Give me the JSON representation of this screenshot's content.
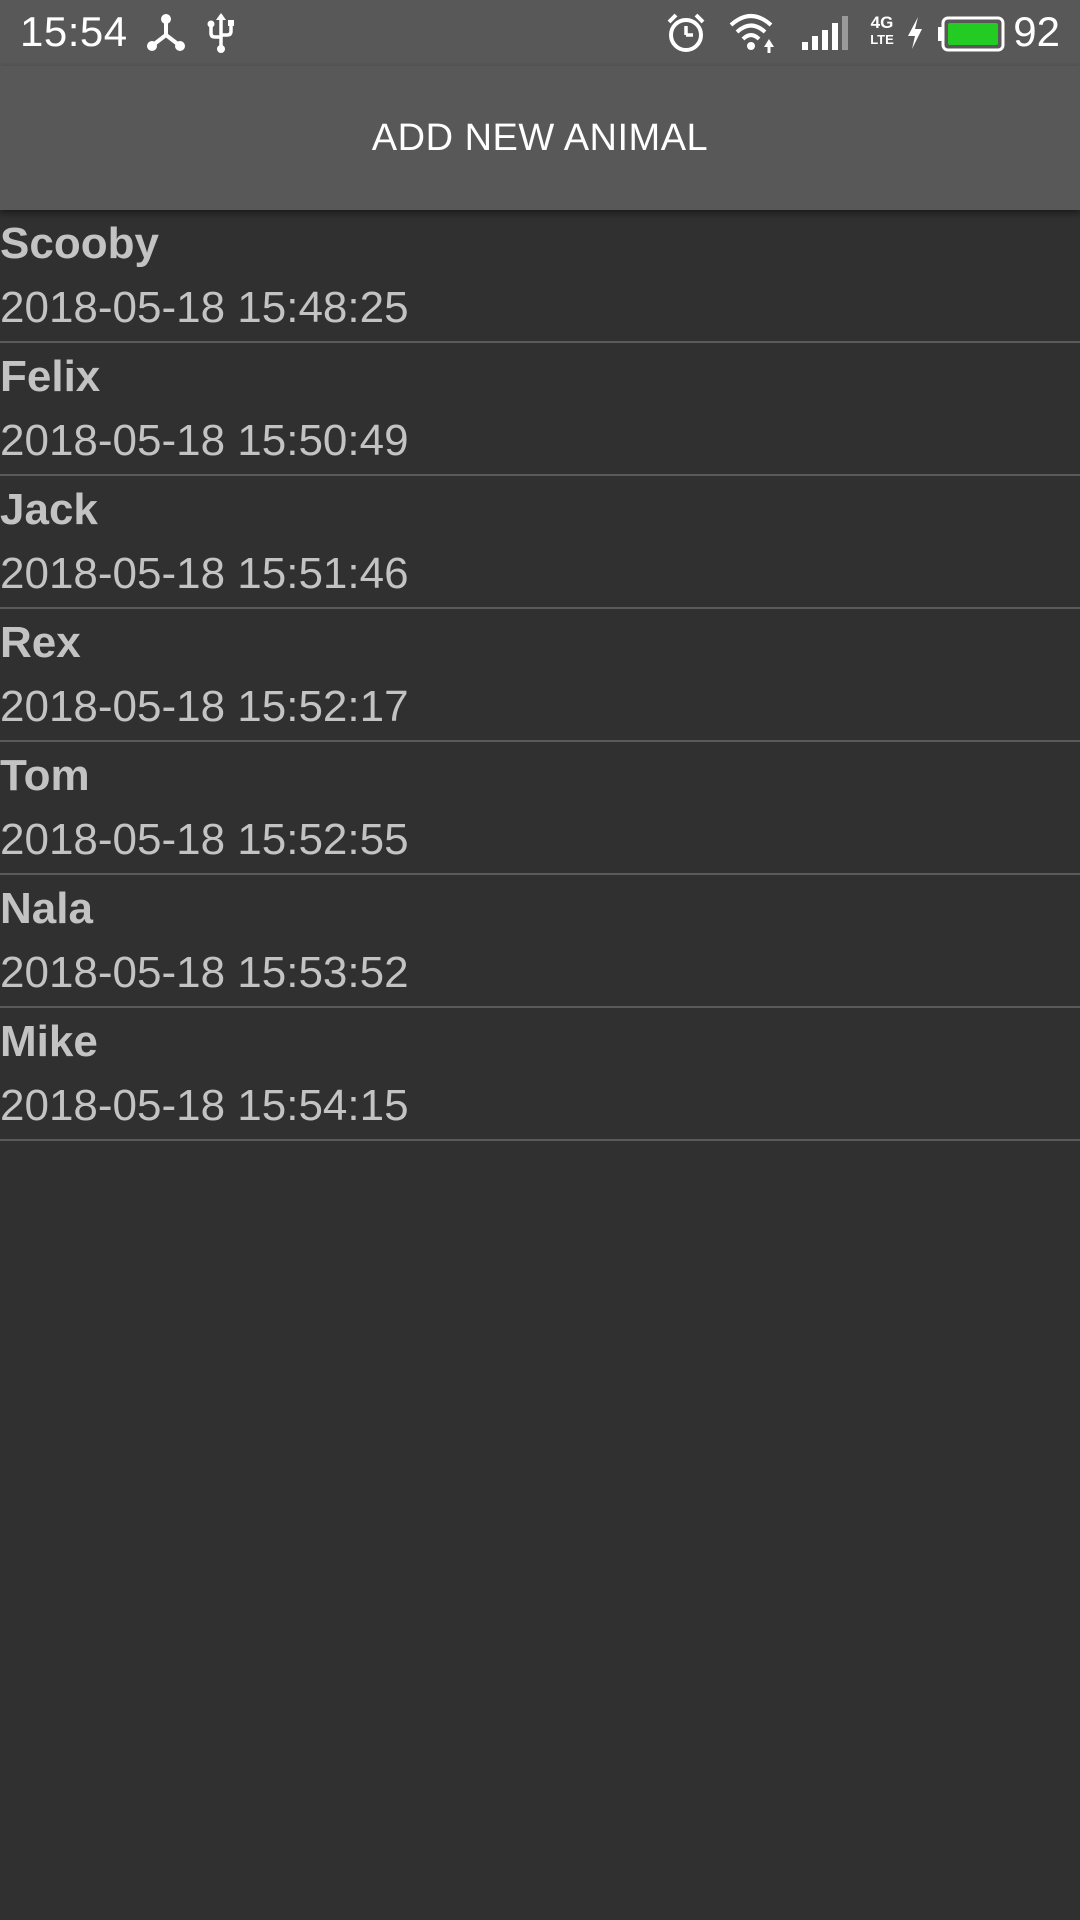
{
  "status_bar": {
    "time": "15:54",
    "battery_percent": "92",
    "network_label_top": "4G",
    "network_label_bottom": "LTE",
    "battery_color": "#22cc22",
    "icons": [
      "connection-icon",
      "usb-icon",
      "alarm-icon",
      "wifi-icon",
      "signal-icon",
      "network-type-icon",
      "charging-icon",
      "battery-icon"
    ]
  },
  "app_bar": {
    "button_label": "ADD NEW ANIMAL"
  },
  "animals": [
    {
      "name": "Scooby",
      "date": "2018-05-18 15:48:25"
    },
    {
      "name": "Felix",
      "date": "2018-05-18 15:50:49"
    },
    {
      "name": "Jack",
      "date": "2018-05-18 15:51:46"
    },
    {
      "name": "Rex",
      "date": "2018-05-18 15:52:17"
    },
    {
      "name": "Tom",
      "date": "2018-05-18 15:52:55"
    },
    {
      "name": "Nala",
      "date": "2018-05-18 15:53:52"
    },
    {
      "name": "Mike",
      "date": "2018-05-18 15:54:15"
    }
  ]
}
